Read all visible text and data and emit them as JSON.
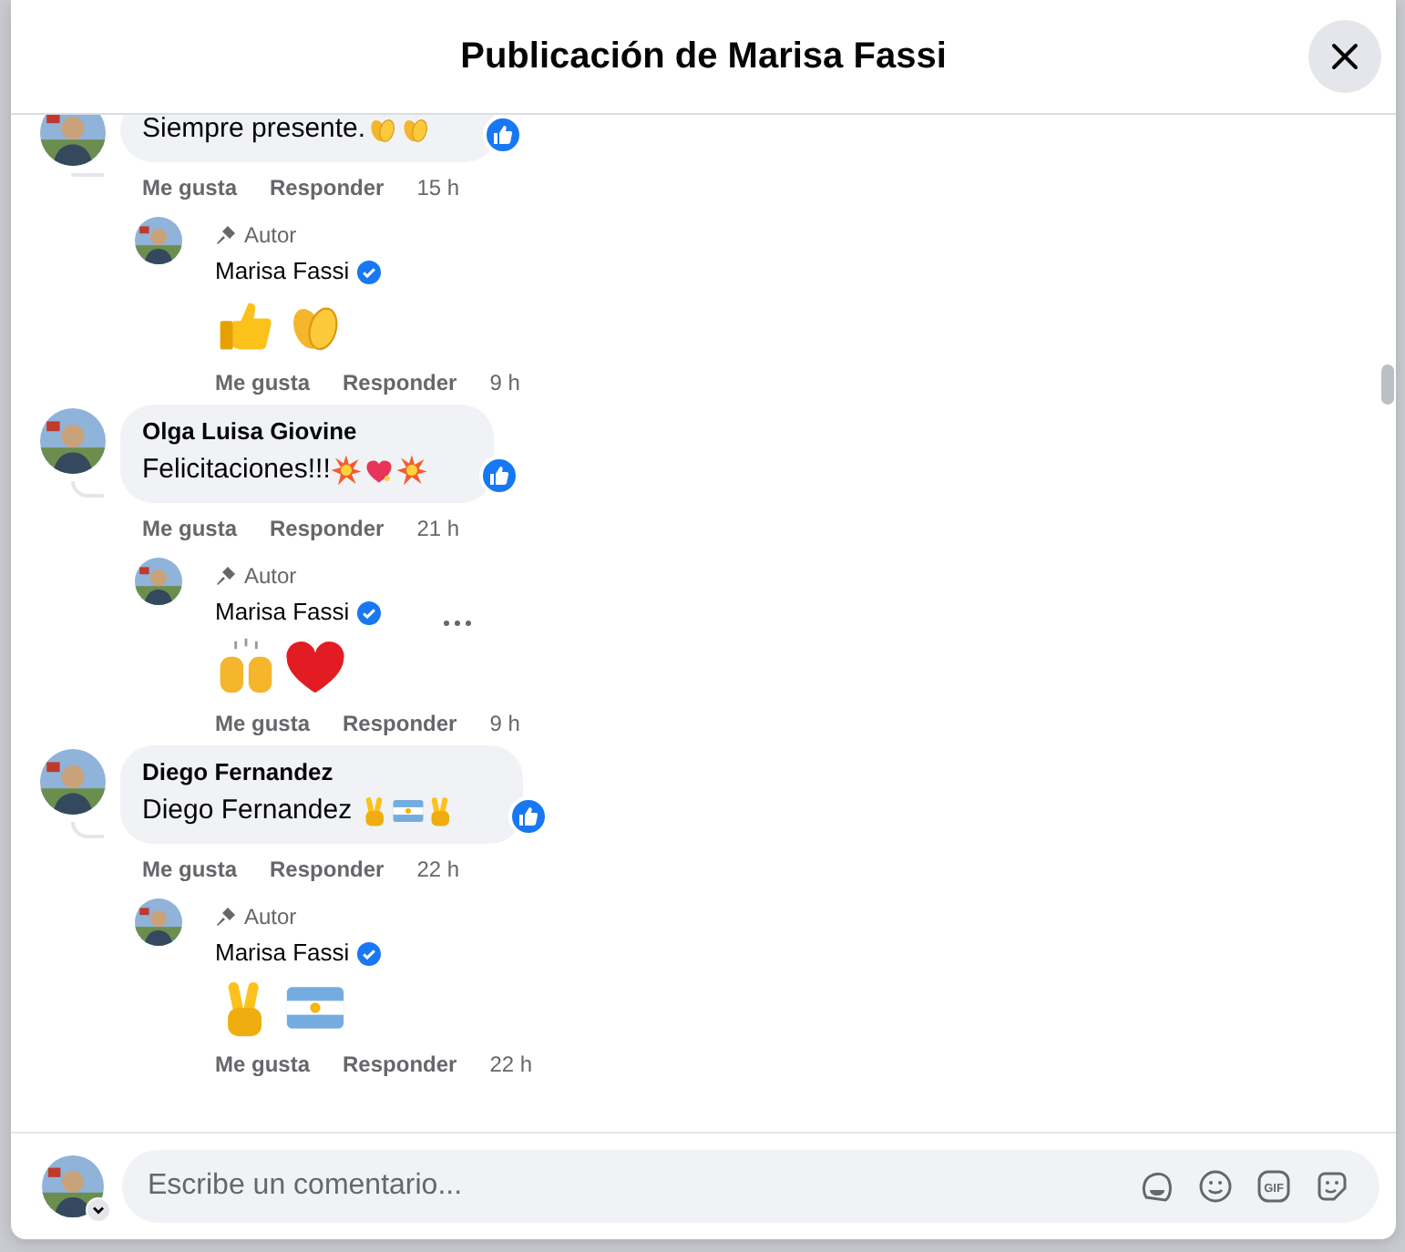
{
  "dialog": {
    "title": "Publicación de Marisa Fassi"
  },
  "comments": [
    {
      "text": "Siempre presente.",
      "emojis": [
        {
          "kind": "clap"
        },
        {
          "kind": "clap"
        }
      ],
      "reacted": true,
      "like": "Me gusta",
      "reply": "Responder",
      "time": "15 h",
      "replies": [
        {
          "badge": "Autor",
          "author": "Marisa Fassi",
          "verified": true,
          "emojis": [
            {
              "kind": "thumbs-up"
            },
            {
              "kind": "clap"
            }
          ],
          "menu": false,
          "like": "Me gusta",
          "reply": "Responder",
          "time": "9 h"
        }
      ]
    },
    {
      "author": "Olga Luisa Giovine",
      "text": "Felicitaciones!!!",
      "emojis": [
        {
          "kind": "collision"
        },
        {
          "kind": "heart-sparkle"
        },
        {
          "kind": "collision"
        }
      ],
      "reacted": true,
      "like": "Me gusta",
      "reply": "Responder",
      "time": "21 h",
      "replies": [
        {
          "badge": "Autor",
          "author": "Marisa Fassi",
          "verified": true,
          "emojis": [
            {
              "kind": "raised-hands"
            },
            {
              "kind": "heart"
            }
          ],
          "menu": true,
          "like": "Me gusta",
          "reply": "Responder",
          "time": "9 h"
        }
      ]
    },
    {
      "author": "Diego Fernandez",
      "text": "Diego Fernandez ",
      "emojis": [
        {
          "kind": "victory"
        },
        {
          "kind": "flag"
        },
        {
          "kind": "victory"
        }
      ],
      "reacted": true,
      "like": "Me gusta",
      "reply": "Responder",
      "time": "22 h",
      "replies": [
        {
          "badge": "Autor",
          "author": "Marisa Fassi",
          "verified": true,
          "emojis": [
            {
              "kind": "victory"
            },
            {
              "kind": "flag"
            }
          ],
          "menu": false,
          "like": "Me gusta",
          "reply": "Responder",
          "time": "22 h"
        }
      ]
    }
  ],
  "composer": {
    "placeholder": "Escribe un comentario...",
    "gif_label": "GIF"
  }
}
